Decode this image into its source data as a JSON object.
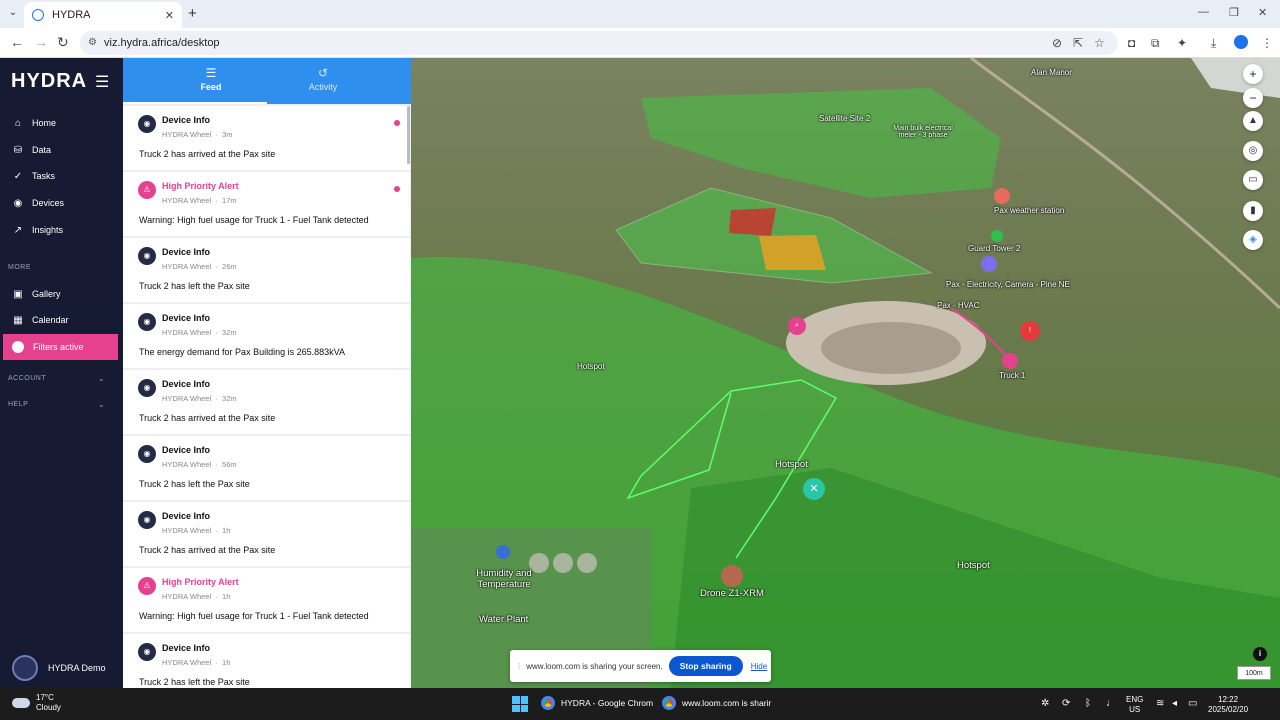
{
  "browser": {
    "tab_title": "HYDRA",
    "url": "viz.hydra.africa/desktop"
  },
  "sidebar": {
    "logo": "HYDRA",
    "items": [
      {
        "label": "Home",
        "icon": "home-icon"
      },
      {
        "label": "Data",
        "icon": "data-icon"
      },
      {
        "label": "Tasks",
        "icon": "tasks-icon"
      },
      {
        "label": "Devices",
        "icon": "devices-icon"
      },
      {
        "label": "Insights",
        "icon": "insights-icon"
      }
    ],
    "more_label": "MORE",
    "more_items": [
      {
        "label": "Gallery",
        "icon": "camera-icon"
      },
      {
        "label": "Calendar",
        "icon": "calendar-icon"
      }
    ],
    "filters_label": "Filters active",
    "account_label": "ACCOUNT",
    "help_label": "HELP",
    "user_name": "HYDRA Demo"
  },
  "feed": {
    "tabs": [
      {
        "label": "Feed",
        "icon": "list-icon",
        "active": true
      },
      {
        "label": "Activity",
        "icon": "history-icon",
        "active": false
      }
    ],
    "cards": [
      {
        "title": "Device Info",
        "source": "HYDRA Wheel",
        "time": "3m",
        "message": "Truck 2 has arrived at the Pax site",
        "type": "info",
        "unread": true
      },
      {
        "title": "High Priority Alert",
        "source": "HYDRA Wheel",
        "time": "17m",
        "message": "Warning: High fuel usage for Truck 1 - Fuel Tank detected",
        "type": "alert",
        "unread": true
      },
      {
        "title": "Device Info",
        "source": "HYDRA Wheel",
        "time": "26m",
        "message": "Truck 2 has left the Pax site",
        "type": "info",
        "unread": false
      },
      {
        "title": "Device Info",
        "source": "HYDRA Wheel",
        "time": "32m",
        "message": "The energy demand for Pax Building is 265.883kVA",
        "type": "info",
        "unread": false
      },
      {
        "title": "Device Info",
        "source": "HYDRA Wheel",
        "time": "32m",
        "message": "Truck 2 has arrived at the Pax site",
        "type": "info",
        "unread": false
      },
      {
        "title": "Device Info",
        "source": "HYDRA Wheel",
        "time": "56m",
        "message": "Truck 2 has left the Pax site",
        "type": "info",
        "unread": false
      },
      {
        "title": "Device Info",
        "source": "HYDRA Wheel",
        "time": "1h",
        "message": "Truck 2 has arrived at the Pax site",
        "type": "info",
        "unread": false
      },
      {
        "title": "High Priority Alert",
        "source": "HYDRA Wheel",
        "time": "1h",
        "message": "Warning: High fuel usage for Truck 1 - Fuel Tank detected",
        "type": "alert",
        "unread": false
      },
      {
        "title": "Device Info",
        "source": "HYDRA Wheel",
        "time": "1h",
        "message": "Truck 2 has left the Pax site",
        "type": "info",
        "unread": false
      }
    ]
  },
  "map": {
    "labels": {
      "alan_manor": "Alan Manor",
      "satellite_site": "Satellite Site 2",
      "main_meter": "Main bulk electrical meter - 3 phase",
      "weather_station": "Pax weather station",
      "guard_tower": "Guard Tower 2",
      "pax_electricity": "Pax - Electricity, Camera - Pine NE",
      "pax_hvac": "Pax - HVAC",
      "truck": "Truck 1",
      "hotspot": "Hotspot",
      "humidity": "Humidity and Temperature",
      "water_plant": "Water Plant",
      "drone": "Drone Z1-XRM"
    },
    "scale_label": "100m",
    "controls": [
      "zoom-in-icon",
      "zoom-out-icon",
      "compass-icon",
      "locate-icon",
      "ruler-icon",
      "lock-icon",
      "layers-icon"
    ]
  },
  "loom": {
    "message": "www.loom.com is sharing your screen.",
    "stop_label": "Stop sharing",
    "hide_label": "Hide"
  },
  "taskbar": {
    "temperature": "17°C",
    "condition": "Cloudy",
    "apps": [
      "HYDRA - Google Chrom",
      "www.loom.com is sharir"
    ],
    "lang": "ENG",
    "region": "US",
    "time": "12:22",
    "date": "2025/02/20"
  },
  "colors": {
    "brand_dark": "#161b33",
    "accent_pink": "#e6418f",
    "feed_blue": "#2f8fef"
  }
}
